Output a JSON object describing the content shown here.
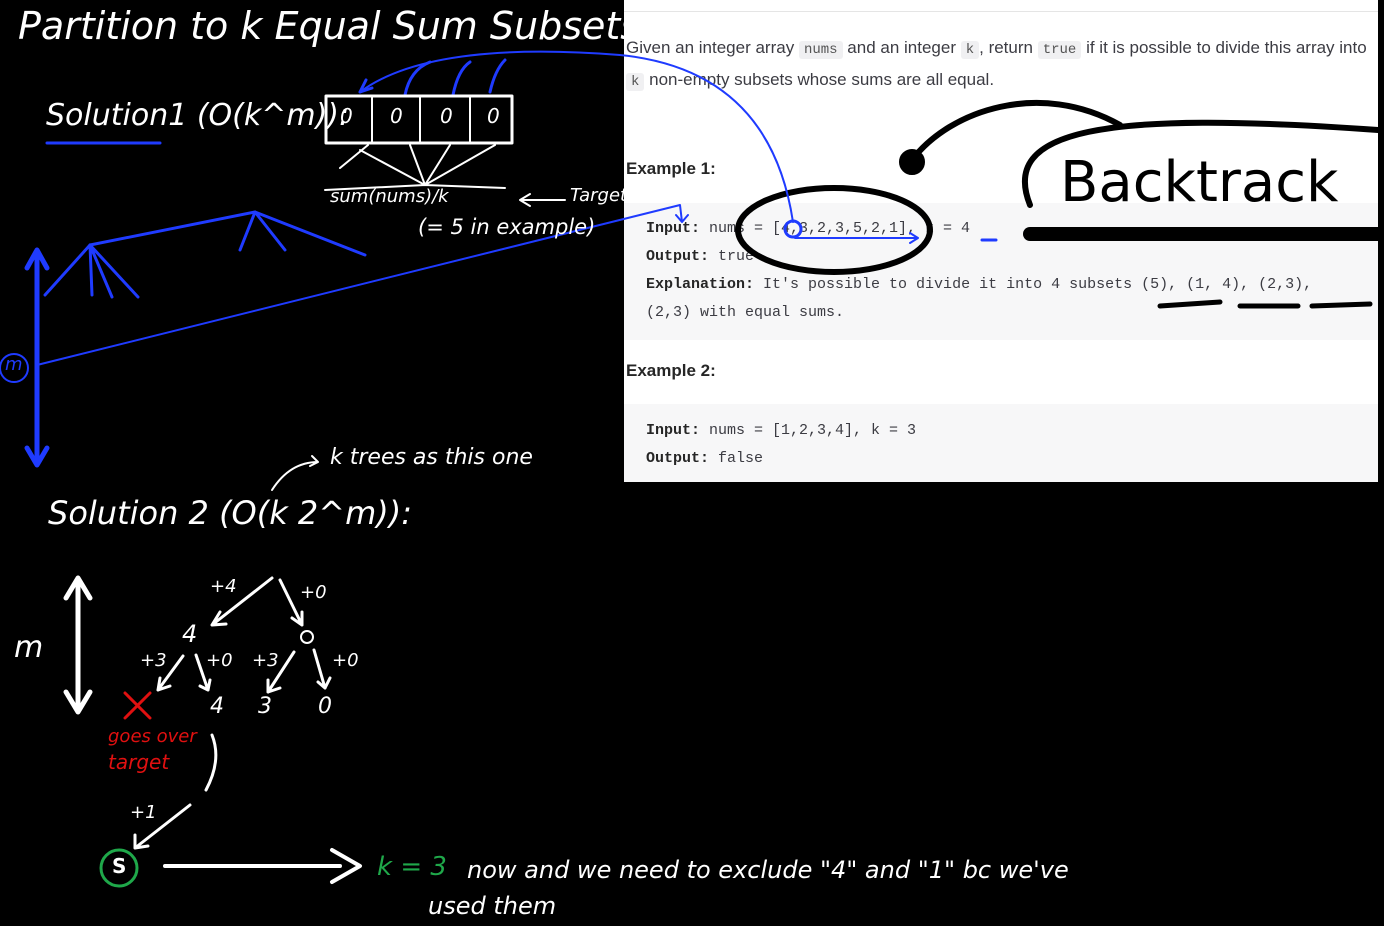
{
  "notes": {
    "title": "Partition to k Equal Sum Subsets :",
    "solution1": "Solution1 (O(k^m)):",
    "buckets": [
      "0",
      "0",
      "0",
      "0"
    ],
    "target_formula": "sum(nums)/k",
    "target_label": "Target",
    "target_example": "(= 5 in example)",
    "m_label": "m",
    "k_trees": "k trees as this one",
    "solution2": "Solution 2 (O(k 2^m)):",
    "tree2": {
      "m_label": "m",
      "edges": [
        "+4",
        "+0",
        "+3",
        "+0",
        "+3",
        "+0",
        "+1"
      ],
      "nodes": [
        "4",
        "0",
        "4",
        "3",
        "0"
      ],
      "goes_over": "goes over",
      "target": "target",
      "start": "S"
    },
    "k_now": "k = 3",
    "explain_line1": "now and we need to exclude \"4\" and \"1\" bc we've",
    "explain_line2": "used them",
    "backtrack": "Backtrack"
  },
  "problem": {
    "desc_1": "Given an integer array",
    "code_nums": "nums",
    "desc_2": "and an integer",
    "code_k": "k",
    "desc_3": ", return",
    "code_true": "true",
    "desc_4": "if it is possible to divide this array into",
    "code_k2": "k",
    "desc_5": "non-empty subsets whose sums are all equal.",
    "example1_title": "Example 1:",
    "ex1_input_label": "Input:",
    "ex1_input": " nums = [4,3,2,3,5,2,1], k = 4",
    "ex1_output_label": "Output:",
    "ex1_output": " true",
    "ex1_expl_label": "Explanation:",
    "ex1_expl": " It's possible to divide it into 4 subsets (5), (1, 4), (2,3),\n(2,3) with equal sums.",
    "example2_title": "Example 2:",
    "ex2_input_label": "Input:",
    "ex2_input": " nums = [1,2,3,4], k = 3",
    "ex2_output_label": "Output:",
    "ex2_output": " false"
  },
  "colors": {
    "blue": "#1f3bff",
    "red": "#e01010",
    "green": "#1fa84a",
    "white": "#ffffff"
  }
}
